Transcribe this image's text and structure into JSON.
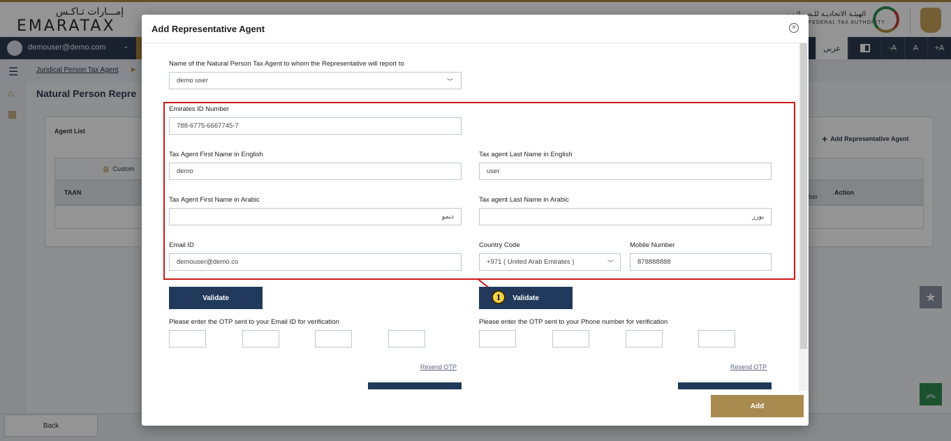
{
  "header": {
    "logo_arabic": "إمـــارات تـاكـس",
    "logo_english": "EMARATAX",
    "authority_arabic": "الهيئـة الاتحاديـة للـضـرائـب",
    "authority_english": "FEDERAL TAX AUTHORITY"
  },
  "userbar": {
    "user": "demouser@demo.com",
    "language": "عربي",
    "font_decrease": "-A",
    "font_normal": "A",
    "font_increase": "+A"
  },
  "breadcrumb": {
    "item": "Juridical Person Tax Agent"
  },
  "page": {
    "title": "Natural Person Repre"
  },
  "agent_section": {
    "title": "Agent List",
    "add_link": "Add Representative Agent",
    "customize": "Custom",
    "col_taan": "TAAN",
    "col_number_fragment": "ber",
    "col_action": "Action"
  },
  "footer": {
    "back_label": "Back"
  },
  "modal": {
    "title": "Add Representative Agent",
    "close_glyph": "×",
    "natural_person_label": "Name of the Natural Person Tax Agent to whom the Representative will report to",
    "natural_person_value": "demo user",
    "emirates_id_label": "Emirates ID Number",
    "emirates_id_value": "788-6775-6667745-7",
    "first_name_en_label": "Tax Agent First Name in English",
    "first_name_en_value": "demo",
    "last_name_en_label": "Tax agent Last Name in English",
    "last_name_en_value": "user",
    "first_name_ar_label": "Tax Agent First Name in Arabic",
    "first_name_ar_value": "ديمو",
    "last_name_ar_label": "Tax agent Last Name in Arabic",
    "last_name_ar_value": "يوزر",
    "email_label": "Email ID",
    "email_value": "demouser@demo.co",
    "country_code_label": "Country Code",
    "country_code_value": "+971 ( United Arab Emirates )",
    "mobile_label": "Mobile Number",
    "mobile_value": "878888888",
    "validate_email_label": "Validate",
    "validate_phone_label": "Validate",
    "step_marker": "1",
    "otp_email_label": "Please enter the OTP sent to your Email ID for verification",
    "otp_phone_label": "Please enter the OTP sent to your Phone number for verification",
    "resend_email_label": "Resend OTP",
    "resend_phone_label": "Resend OTP",
    "add_label": "Add"
  },
  "colors": {
    "navy": "#213a5b",
    "gold": "#a98a4f",
    "highlight_red": "#d01818",
    "marker_yellow": "#f7d34a"
  }
}
